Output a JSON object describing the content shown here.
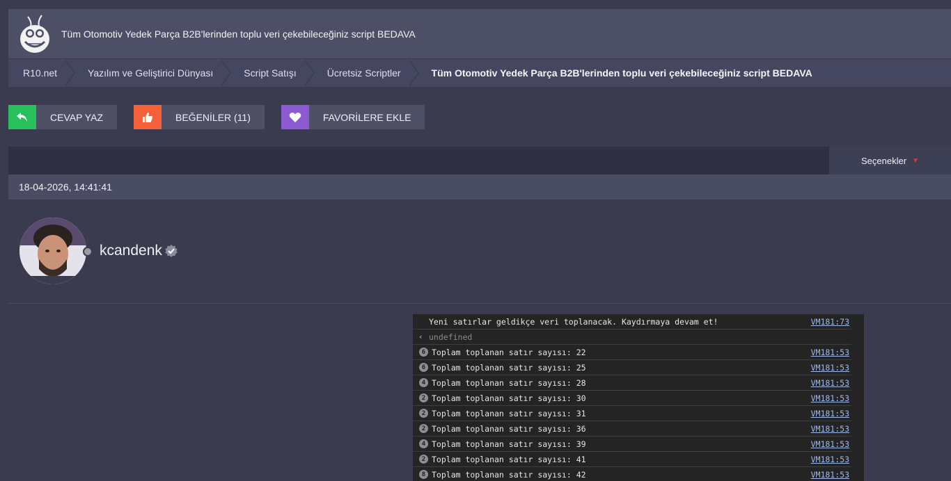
{
  "header": {
    "title": "Tüm Otomotiv Yedek Parça B2B'lerinden toplu veri çekebileceğiniz script BEDAVA"
  },
  "breadcrumb": [
    {
      "label": "R10.net"
    },
    {
      "label": "Yazılım ve Geliştirici Dünyası"
    },
    {
      "label": "Script Satışı"
    },
    {
      "label": "Ücretsiz Scriptler"
    },
    {
      "label": "Tüm Otomotiv Yedek Parça B2B'lerinden toplu veri çekebileceğiniz script BEDAVA"
    }
  ],
  "actions": {
    "reply": "CEVAP YAZ",
    "likes": "BEĞENİLER (11)",
    "favorite": "FAVORİLERE EKLE"
  },
  "post": {
    "options_label": "Seçenekler",
    "date": "18-04-2026, 14:41:41",
    "username": "kcandenk"
  },
  "console": {
    "lines": [
      {
        "type": "info",
        "text": "Yeni satırlar geldikçe veri toplanacak. Kaydırmaya devam et!",
        "src": "VM181:73"
      },
      {
        "type": "undef",
        "text": "undefined",
        "src": ""
      },
      {
        "type": "log",
        "count": "6",
        "text": "Toplam toplanan satır sayısı: 22",
        "src": "VM181:53"
      },
      {
        "type": "log",
        "count": "6",
        "text": "Toplam toplanan satır sayısı: 25",
        "src": "VM181:53"
      },
      {
        "type": "log",
        "count": "4",
        "text": "Toplam toplanan satır sayısı: 28",
        "src": "VM181:53"
      },
      {
        "type": "log",
        "count": "2",
        "text": "Toplam toplanan satır sayısı: 30",
        "src": "VM181:53"
      },
      {
        "type": "log",
        "count": "2",
        "text": "Toplam toplanan satır sayısı: 31",
        "src": "VM181:53"
      },
      {
        "type": "log",
        "count": "2",
        "text": "Toplam toplanan satır sayısı: 36",
        "src": "VM181:53"
      },
      {
        "type": "log",
        "count": "4",
        "text": "Toplam toplanan satır sayısı: 39",
        "src": "VM181:53"
      },
      {
        "type": "log",
        "count": "2",
        "text": "Toplam toplanan satır sayısı: 41",
        "src": "VM181:53"
      },
      {
        "type": "log",
        "count": "8",
        "text": "Toplam toplanan satır sayısı: 42",
        "src": "VM181:53"
      }
    ]
  }
}
